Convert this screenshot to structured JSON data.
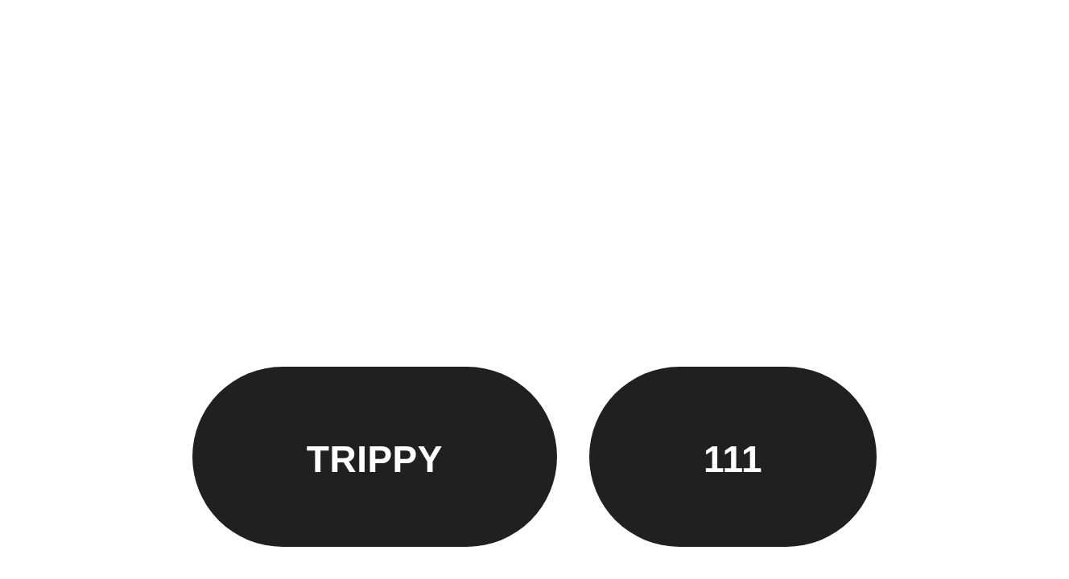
{
  "buttons": [
    {
      "label": "TRIPPY"
    },
    {
      "label": "111"
    }
  ]
}
